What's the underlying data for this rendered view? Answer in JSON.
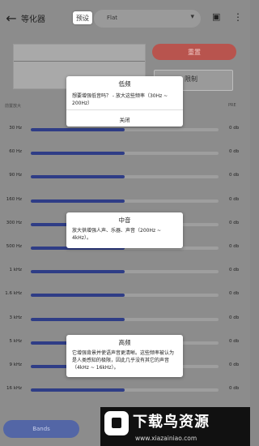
{
  "header": {
    "back_icon": "arrow-left-icon",
    "title": "等化器",
    "preset_label": "预设",
    "preset_value": "Flat",
    "save_icon": "save-icon",
    "more_icon": "more-vert-icon"
  },
  "controls": {
    "reset_label": "重置",
    "limit_label": "限制"
  },
  "labels": {
    "left": "前置放大",
    "right": "PRE"
  },
  "bands": [
    {
      "freq": "30 Hz",
      "value": 0.5,
      "db": "0 db"
    },
    {
      "freq": "60 Hz",
      "value": 0.5,
      "db": "0 db"
    },
    {
      "freq": "90 Hz",
      "value": 0.5,
      "db": "0 db"
    },
    {
      "freq": "160 Hz",
      "value": 0.5,
      "db": "0 db"
    },
    {
      "freq": "300 Hz",
      "value": 0.5,
      "db": "0 db"
    },
    {
      "freq": "500 Hz",
      "value": 0.5,
      "db": "0 db"
    },
    {
      "freq": "1 kHz",
      "value": 0.5,
      "db": "0 db"
    },
    {
      "freq": "1.6 kHz",
      "value": 0.5,
      "db": "0 db"
    },
    {
      "freq": "3 kHz",
      "value": 0.5,
      "db": "0 db"
    },
    {
      "freq": "5 kHz",
      "value": 0.5,
      "db": "0 db"
    },
    {
      "freq": "9 kHz",
      "value": 0.5,
      "db": "0 db"
    },
    {
      "freq": "16 kHz",
      "value": 0.5,
      "db": "0 db"
    }
  ],
  "bands_button": "Bands",
  "tooltips": {
    "low": {
      "title": "低频",
      "body": "想要增强低音吗？ - 放大这些频率（30Hz ~ 200Hz）",
      "close": "关闭"
    },
    "mid": {
      "title": "中音",
      "body": "放大供增强人声、乐器、声音（200Hz ~ 4kHz）。"
    },
    "high": {
      "title": "高频",
      "body": "它增强背景并使语声音更清晰。这些频率被认为是人类感知的极限，因此几乎没有其它的声音（4kHz ~ 16kHz）。"
    }
  },
  "watermark": {
    "title": "下载鸟资源",
    "url": "www.xiazainiao.com"
  }
}
